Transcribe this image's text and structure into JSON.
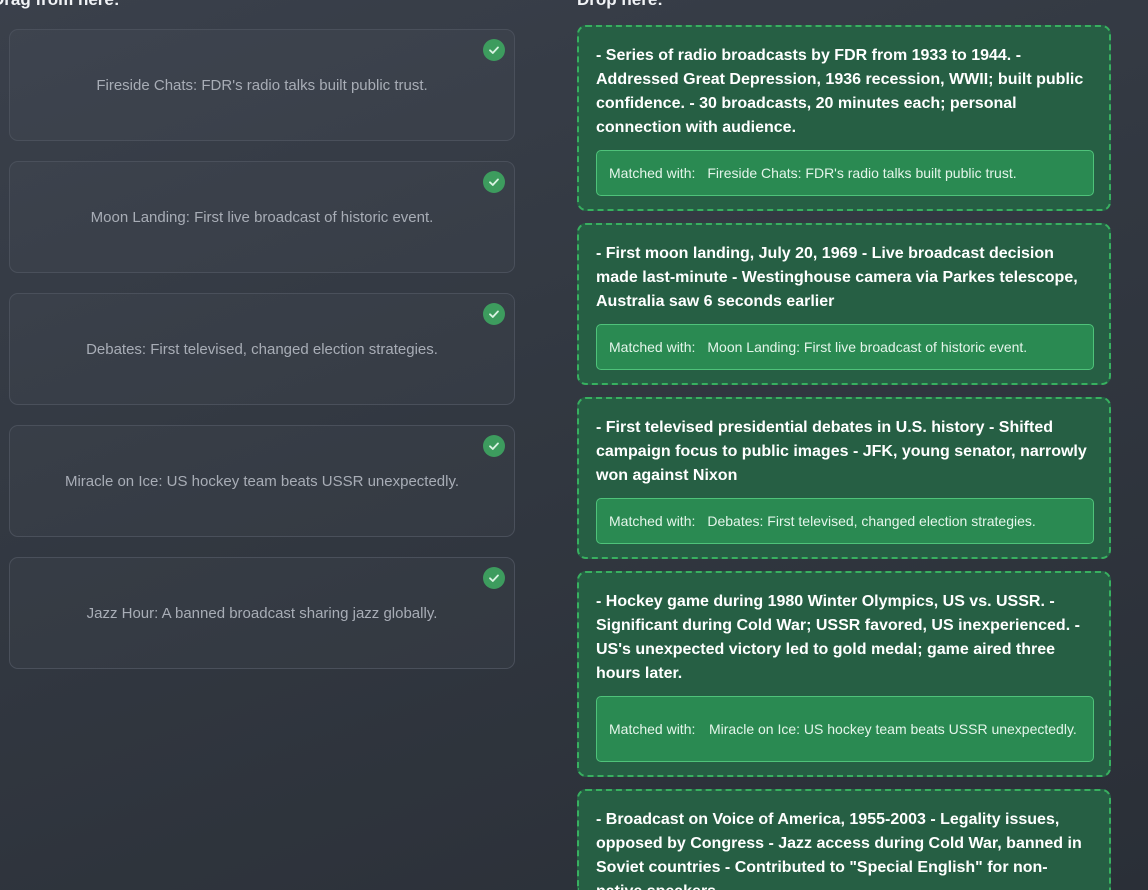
{
  "headings": {
    "drag": "Drag from here:",
    "drop": "Drop here:"
  },
  "colors": {
    "background": "#323841",
    "card_border": "#4a505b",
    "drop_background": "#265f44",
    "drop_border": "#38b060",
    "match_background": "#2a8a52",
    "check_badge": "#3d9c5e"
  },
  "source_items": [
    {
      "text": "Fireside Chats: FDR's radio talks built public trust.",
      "icon": "check-circle-icon",
      "matched": true
    },
    {
      "text": "Moon Landing: First live broadcast of historic event.",
      "icon": "check-circle-icon",
      "matched": true
    },
    {
      "text": "Debates: First televised, changed election strategies.",
      "icon": "check-circle-icon",
      "matched": true
    },
    {
      "text": "Miracle on Ice: US hockey team beats USSR unexpectedly.",
      "icon": "check-circle-icon",
      "matched": true
    },
    {
      "text": "Jazz Hour: A banned broadcast sharing jazz globally.",
      "icon": "check-circle-icon",
      "matched": true
    }
  ],
  "drop_targets": [
    {
      "description": "- Series of radio broadcasts by FDR from 1933 to 1944. - Addressed Great Depression, 1936 recession, WWII; built public confidence. - 30 broadcasts, 20 minutes each; personal connection with audience.",
      "match_label": "Matched with:",
      "match_value": "Fireside Chats: FDR's radio talks built public trust."
    },
    {
      "description": "- First moon landing, July 20, 1969 - Live broadcast decision made last-minute - Westinghouse camera via Parkes telescope, Australia saw 6 seconds earlier",
      "match_label": "Matched with:",
      "match_value": "Moon Landing: First live broadcast of historic event."
    },
    {
      "description": "- First televised presidential debates in U.S. history - Shifted campaign focus to public images - JFK, young senator, narrowly won against Nixon",
      "match_label": "Matched with:",
      "match_value": "Debates: First televised, changed election strategies."
    },
    {
      "description": "- Hockey game during 1980 Winter Olympics, US vs. USSR. - Significant during Cold War; USSR favored, US inexperienced. - US's unexpected victory led to gold medal; game aired three hours later.",
      "match_label": "Matched with:",
      "match_value": "Miracle on Ice: US hockey team beats USSR unexpectedly."
    },
    {
      "description": "- Broadcast on Voice of America, 1955-2003 - Legality issues, opposed by Congress - Jazz access during Cold War, banned in Soviet countries - Contributed to \"Special English\" for non-native speakers."
    }
  ]
}
